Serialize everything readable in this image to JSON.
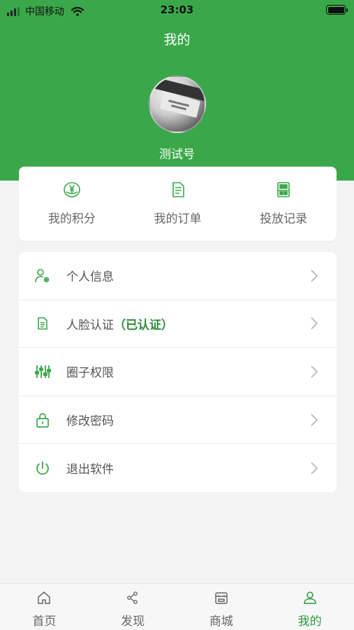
{
  "status_bar": {
    "carrier": "中国移动",
    "time": "23:03"
  },
  "header": {
    "title": "我的",
    "username": "测试号"
  },
  "quick_actions": [
    {
      "label": "我的积分",
      "icon": "coin-yen-icon"
    },
    {
      "label": "我的订单",
      "icon": "document-icon"
    },
    {
      "label": "投放记录",
      "icon": "bin-record-icon"
    }
  ],
  "menu": [
    {
      "label": "个人信息",
      "icon": "user-settings-icon"
    },
    {
      "label": "人脸认证",
      "status": "（已认证）",
      "icon": "file-icon"
    },
    {
      "label": "圈子权限",
      "icon": "sliders-icon"
    },
    {
      "label": "修改密码",
      "icon": "lock-icon"
    },
    {
      "label": "退出软件",
      "icon": "power-icon"
    }
  ],
  "tabs": [
    {
      "label": "首页",
      "icon": "home-icon",
      "active": false
    },
    {
      "label": "发现",
      "icon": "share-icon",
      "active": false
    },
    {
      "label": "商城",
      "icon": "store-icon",
      "active": false
    },
    {
      "label": "我的",
      "icon": "user-icon",
      "active": true
    }
  ],
  "colors": {
    "brand": "#3aa84a",
    "active_tab": "#2e9a3e",
    "verified": "#2e8b3a"
  }
}
